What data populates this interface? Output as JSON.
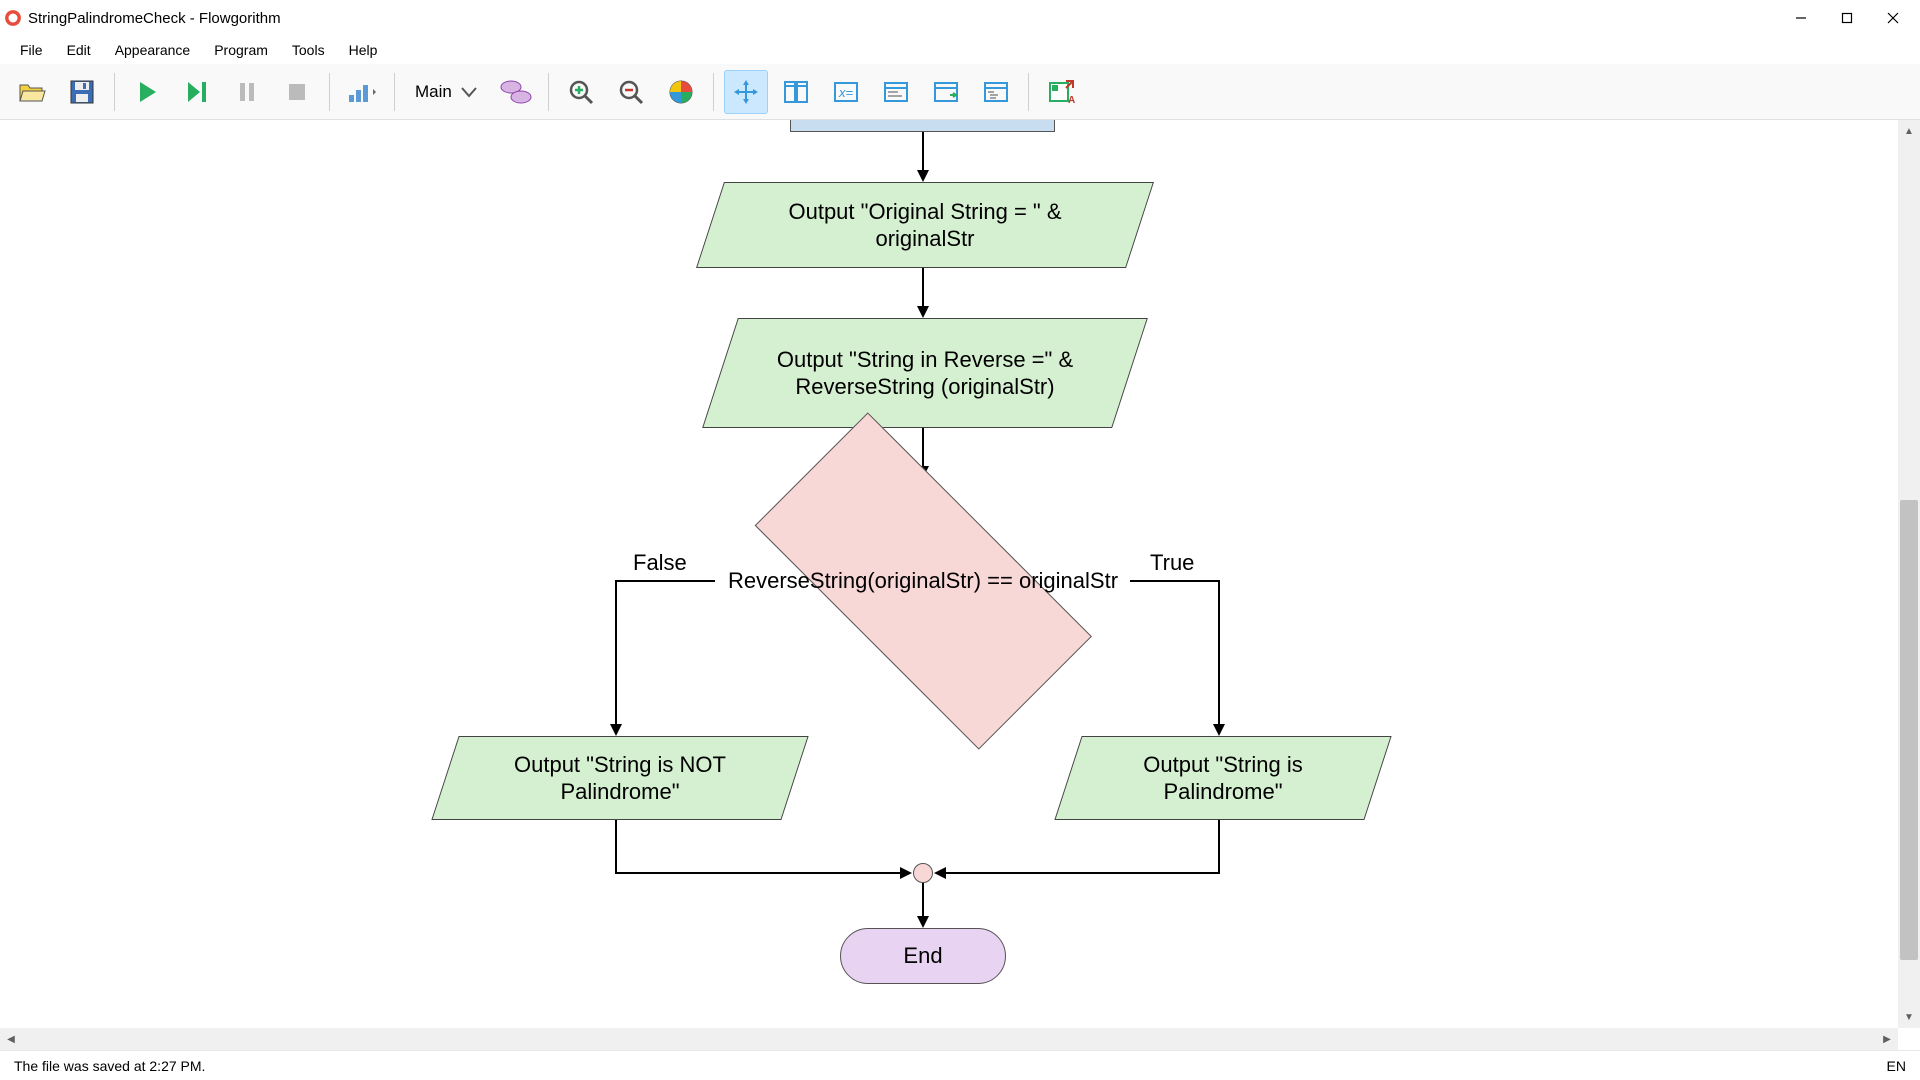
{
  "title": "StringPalindromeCheck - Flowgorithm",
  "menu": {
    "file": "File",
    "edit": "Edit",
    "appearance": "Appearance",
    "program": "Program",
    "tools": "Tools",
    "help": "Help"
  },
  "toolbar": {
    "function": "Main"
  },
  "flow": {
    "out1": "Output \"Original String = \" & originalStr",
    "out2": "Output \"String in Reverse =\" & ReverseString (originalStr)",
    "cond": "ReverseString(originalStr) == originalStr",
    "false_label": "False",
    "true_label": "True",
    "out_false": "Output \"String is NOT Palindrome\"",
    "out_true": "Output \"String is Palindrome\"",
    "end": "End"
  },
  "status": {
    "msg": "The file was saved at 2:27 PM.",
    "lang": "EN"
  }
}
